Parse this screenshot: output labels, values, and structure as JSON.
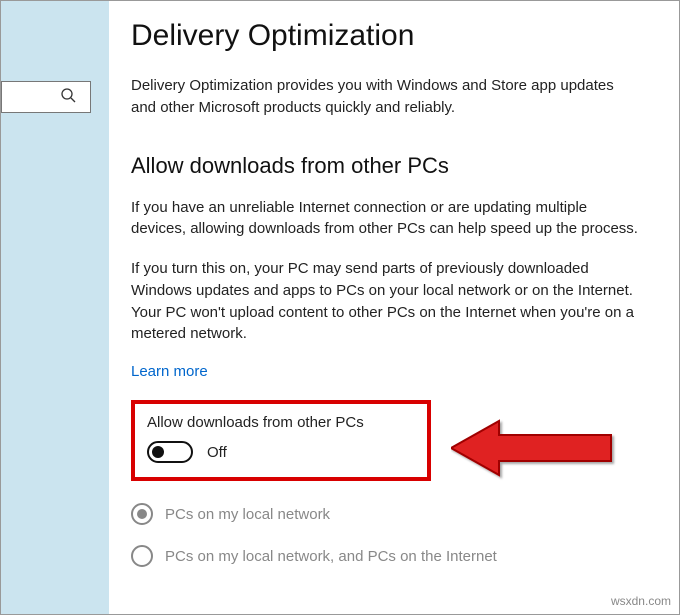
{
  "header": {
    "title": "Delivery Optimization",
    "description": "Delivery Optimization provides you with Windows and Store app updates and other Microsoft products quickly and reliably."
  },
  "section": {
    "heading": "Allow downloads from other PCs",
    "para1": "If you have an unreliable Internet connection or are updating multiple devices, allowing downloads from other PCs can help speed up the process.",
    "para2": "If you turn this on, your PC may send parts of previously downloaded Windows updates and apps to PCs on your local network or on the Internet. Your PC won't upload content to other PCs on the Internet when you're on a metered network.",
    "learn_more": "Learn more"
  },
  "toggle": {
    "label": "Allow downloads from other PCs",
    "state": "Off"
  },
  "radios": {
    "option1": "PCs on my local network",
    "option2": "PCs on my local network, and PCs on the Internet"
  },
  "watermark": "wsxdn.com"
}
